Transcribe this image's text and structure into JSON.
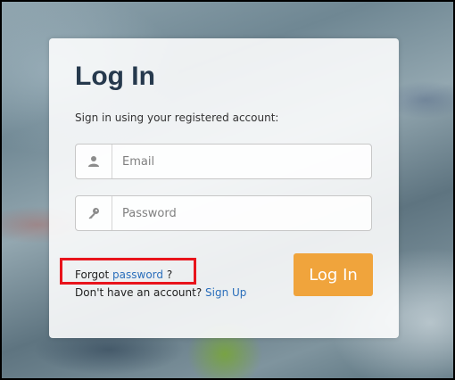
{
  "login": {
    "title": "Log In",
    "subtitle": "Sign in using your registered account:",
    "email_placeholder": "Email",
    "password_placeholder": "Password",
    "forgot_prefix": "Forgot ",
    "forgot_link": "password",
    "forgot_suffix": " ?",
    "signup_prefix": "Don't have an account? ",
    "signup_link": "Sign Up",
    "login_button": "Log In"
  },
  "icons": {
    "email_icon": "user-icon",
    "password_icon": "key-icon"
  },
  "colors": {
    "title": "#26394d",
    "link": "#2a6ebb",
    "button": "#f0a43c",
    "highlight": "#e8141c"
  }
}
